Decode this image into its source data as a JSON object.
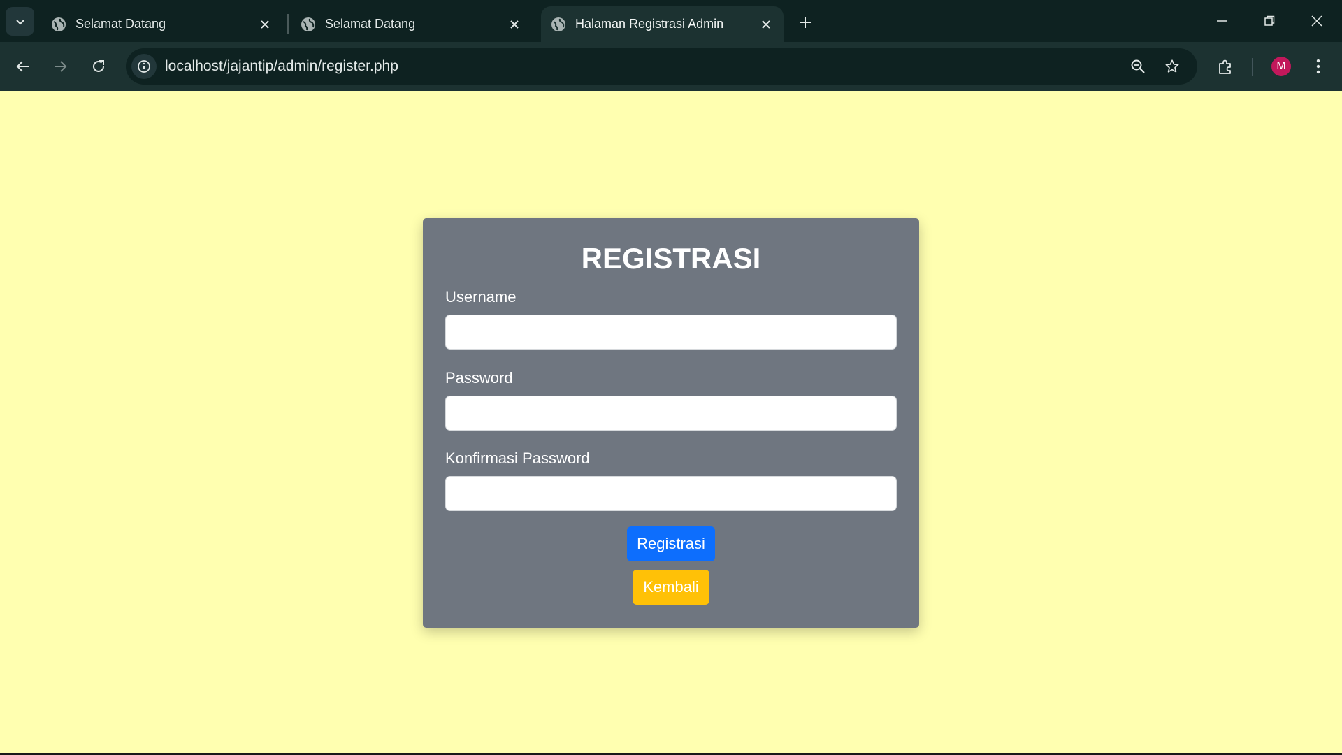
{
  "browser": {
    "tabs": [
      {
        "title": "Selamat Datang",
        "active": false
      },
      {
        "title": "Selamat Datang",
        "active": false
      },
      {
        "title": "Halaman Registrasi Admin",
        "active": true
      }
    ],
    "url": "localhost/jajantip/admin/register.php",
    "profile_initial": "M",
    "colors": {
      "frame": "#0e2221",
      "toolbar": "#1c3231",
      "avatar": "#c2185b"
    }
  },
  "page": {
    "background": "#ffffb0",
    "form": {
      "title": "REGISTRASI",
      "username_label": "Username",
      "username_value": "",
      "password_label": "Password",
      "password_value": "",
      "confirm_label": "Konfirmasi Password",
      "confirm_value": "",
      "register_button": "Registrasi",
      "back_button": "Kembali"
    },
    "colors": {
      "card": "#6f7680",
      "primary": "#0d6efd",
      "warning": "#ffc107"
    }
  }
}
